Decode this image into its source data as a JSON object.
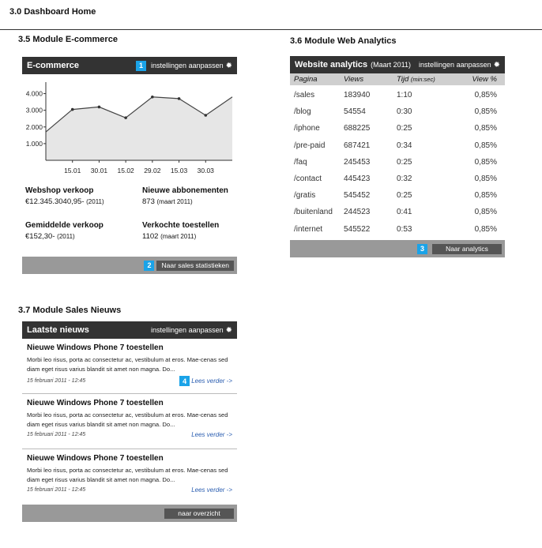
{
  "page": {
    "title": "3.0 Dashboard Home"
  },
  "ecommerce": {
    "section_title": "3.5  Module E-commerce",
    "header_title": "E-commerce",
    "badge": "1",
    "settings_label": "instellingen aanpassen",
    "stats": [
      {
        "label": "Webshop verkoop",
        "value": "€12.345.3040,95-",
        "sub": "(2011)"
      },
      {
        "label": "Nieuwe abbonementen",
        "value": "873",
        "sub": "(maart 2011)"
      },
      {
        "label": "Gemiddelde verkoop",
        "value": "€152,30-",
        "sub": "(2011)"
      },
      {
        "label": "Verkochte toestellen",
        "value": "1102",
        "sub": "(maart 2011)"
      }
    ],
    "footer_badge": "2",
    "footer_button": "Naar sales statistieken"
  },
  "chart_data": {
    "type": "area",
    "categories": [
      "15.01",
      "30.01",
      "15.02",
      "29.02",
      "15.03",
      "30.03"
    ],
    "series": [
      {
        "values": [
          1700,
          3050,
          3200,
          2550,
          3800,
          3700,
          2700,
          3800
        ]
      }
    ],
    "y_ticks": [
      "1.000",
      "2.000",
      "3.000",
      "4.000"
    ],
    "ylim": [
      0,
      4500
    ],
    "colors": {
      "fill": "#e6e6e6",
      "line": "#444444"
    }
  },
  "web_analytics": {
    "section_title": "3.6 Module Web Analytics",
    "header_title": "Website analytics",
    "header_sub": "(Maart 2011)",
    "settings_label": "instellingen aanpassen",
    "columns": {
      "page": "Pagina",
      "views": "Views",
      "time": "Tijd",
      "time_unit": "(min:sec)",
      "viewpct": "View %"
    },
    "rows": [
      {
        "page": "/sales",
        "views": "183940",
        "time": "1:10",
        "pct": "0,85%"
      },
      {
        "page": "/blog",
        "views": "54554",
        "time": "0:30",
        "pct": "0,85%"
      },
      {
        "page": "/iphone",
        "views": "688225",
        "time": "0:25",
        "pct": "0,85%"
      },
      {
        "page": "/pre-paid",
        "views": "687421",
        "time": "0:34",
        "pct": "0,85%"
      },
      {
        "page": "/faq",
        "views": "245453",
        "time": "0:25",
        "pct": "0,85%"
      },
      {
        "page": "/contact",
        "views": "445423",
        "time": "0:32",
        "pct": "0,85%"
      },
      {
        "page": "/gratis",
        "views": "545452",
        "time": "0:25",
        "pct": "0,85%"
      },
      {
        "page": "/buitenland",
        "views": "244523",
        "time": "0:41",
        "pct": "0,85%"
      },
      {
        "page": "/internet",
        "views": "545522",
        "time": "0:53",
        "pct": "0,85%"
      }
    ],
    "footer_badge": "3",
    "footer_button": "Naar analytics"
  },
  "news": {
    "section_title": "3.7  Module Sales Nieuws",
    "header_title": "Laatste nieuws",
    "settings_label": "instellingen aanpassen",
    "items": [
      {
        "title": "Nieuwe Windows Phone 7 toestellen",
        "body": "Morbi leo risus, porta ac consectetur ac, vestibulum at eros. Mae-cenas sed diam eget risus varius blandit sit amet non magna. Do...",
        "date": "15 februari 2011 - 12:45",
        "more": "Lees verder ->",
        "badge": "4"
      },
      {
        "title": "Nieuwe Windows Phone 7 toestellen",
        "body": "Morbi leo risus, porta ac consectetur ac, vestibulum at eros. Mae-cenas sed diam eget risus varius blandit sit amet non magna. Do...",
        "date": "15 februari 2011 - 12:45",
        "more": "Lees verder ->"
      },
      {
        "title": "Nieuwe Windows Phone 7 toestellen",
        "body": "Morbi leo risus, porta ac consectetur ac, vestibulum at eros. Mae-cenas sed diam eget risus varius blandit sit amet non magna. Do...",
        "date": "15 februari 2011 - 12:45",
        "more": "Lees verder ->"
      }
    ],
    "footer_button": "naar overzicht"
  },
  "icons": {
    "settings": "gear-icon"
  },
  "colors": {
    "header_bg": "#333333",
    "footer_bg": "#999999",
    "button_bg": "#555555",
    "badge": "#1aa3e8",
    "link": "#2a5db0"
  }
}
